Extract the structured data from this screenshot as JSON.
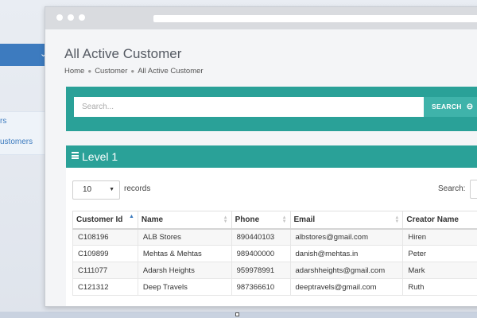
{
  "sidebar": {
    "items": [
      {
        "label": "rs"
      },
      {
        "label": "ustomers"
      }
    ]
  },
  "page": {
    "title": "All Active Customer",
    "breadcrumb": [
      "Home",
      "Customer",
      "All Active Customer"
    ]
  },
  "search_panel": {
    "placeholder": "Search...",
    "button_label": "SEARCH"
  },
  "table_panel": {
    "title": "Level 1",
    "page_length": "10",
    "records_label": "records",
    "search_label": "Search:",
    "columns": [
      "Customer Id",
      "Name",
      "Phone",
      "Email",
      "Creator Name"
    ],
    "rows": [
      [
        "C108196",
        "ALB Stores",
        "890440103",
        "albstores@gmail.com",
        "Hiren"
      ],
      [
        "C109899",
        "Mehtas & Mehtas",
        "989400000",
        "danish@mehtas.in",
        "Peter"
      ],
      [
        "C111077",
        "Adarsh Heights",
        "959978991",
        "adarshheights@gmail.com",
        "Mark"
      ],
      [
        "C121312",
        "Deep Travels",
        "987366610",
        "deeptravels@gmail.com",
        "Ruth"
      ]
    ]
  },
  "colors": {
    "accent_teal": "#2aa198",
    "sidebar_blue": "#3d7bbf"
  }
}
